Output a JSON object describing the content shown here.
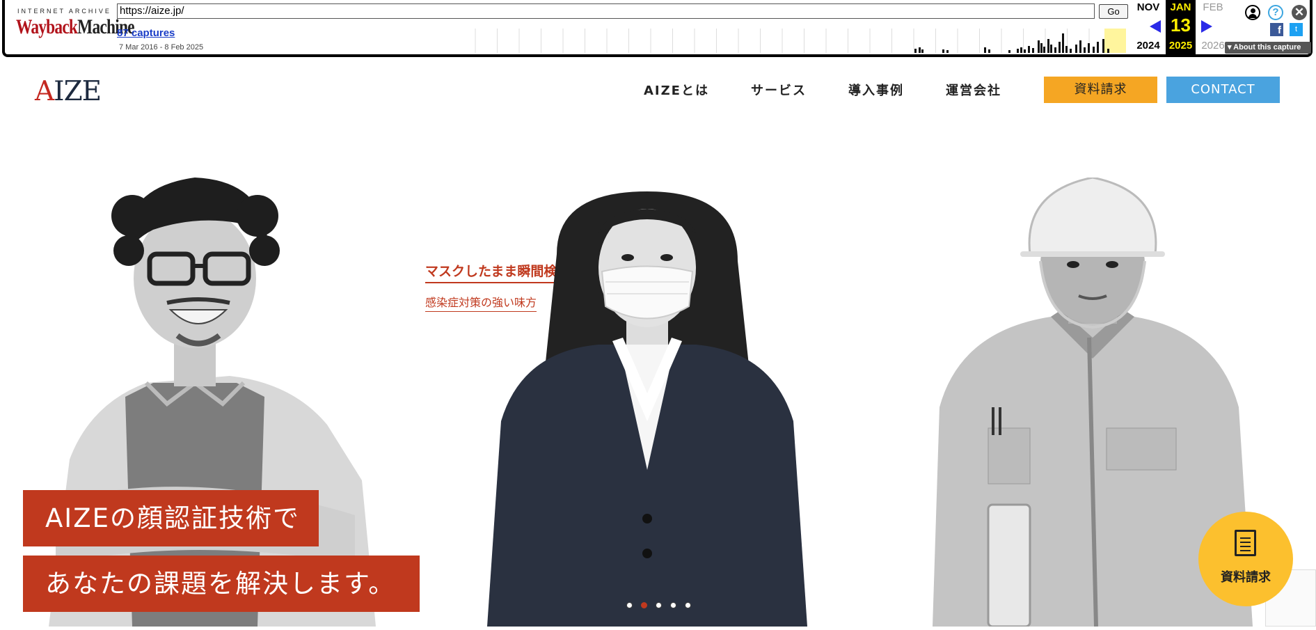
{
  "wayback": {
    "logo_top": "INTERNET ARCHIVE",
    "logo_way": "Wayback",
    "logo_machine": "Machine",
    "url": "https://aize.jp/",
    "go_label": "Go",
    "captures": "87 captures",
    "range": "7 Mar 2016 - 8 Feb 2025",
    "prev_month": "NOV",
    "prev_year": "2024",
    "cur_month": "JAN",
    "cur_day": "13",
    "cur_year": "2025",
    "next_month": "FEB",
    "next_year": "2026",
    "about": "About this capture",
    "help": "?",
    "close": "✕",
    "facebook": "f",
    "twitter": "t",
    "highlight_color": "#fff59d"
  },
  "header": {
    "logo_a": "A",
    "logo_rest": "IZE",
    "nav": [
      "AIZEとは",
      "サービス",
      "導入事例",
      "運営会社"
    ],
    "doc_button": "資料請求",
    "contact_button": "CONTACT"
  },
  "hero": {
    "tag_main": "マスクしたまま瞬間検温",
    "tag_sub": "感染症対策の強い味方",
    "caption_line1": "AIZEの顔認証技術で",
    "caption_line2": "あなたの課題を解決します。",
    "slides": 5,
    "active_slide": 2
  },
  "fab": {
    "label": "資料請求"
  },
  "colors": {
    "brand_red": "#c0391e",
    "doc_orange": "#f5a623",
    "contact_blue": "#4aa3df",
    "fab_yellow": "#fcc02e"
  }
}
